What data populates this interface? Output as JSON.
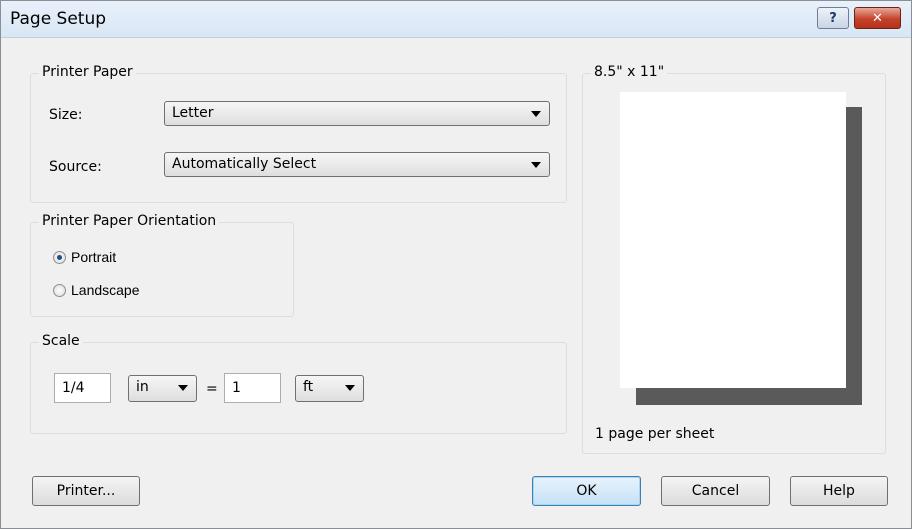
{
  "window": {
    "title": "Page Setup",
    "help_glyph": "?",
    "close_glyph": "✕"
  },
  "printer_paper": {
    "legend": "Printer Paper",
    "size_label": "Size:",
    "size_value": "Letter",
    "source_label": "Source:",
    "source_value": "Automatically Select"
  },
  "orientation": {
    "legend": "Printer Paper Orientation",
    "options": [
      {
        "label": "Portrait",
        "checked": true
      },
      {
        "label": "Landscape",
        "checked": false
      }
    ]
  },
  "scale": {
    "legend": "Scale",
    "left_value": "1/4",
    "left_unit": "in",
    "equals": "=",
    "right_value": "1",
    "right_unit": "ft"
  },
  "preview": {
    "legend": "8.5\" x 11\"",
    "caption": "1 page per sheet"
  },
  "buttons": {
    "printer": "Printer...",
    "ok": "OK",
    "cancel": "Cancel",
    "help": "Help"
  },
  "colors": {
    "title_bar": "#dce8f5",
    "close_button": "#c4422a",
    "default_button": "#c5e1f6",
    "paper_shadow": "#5a5a5a"
  }
}
